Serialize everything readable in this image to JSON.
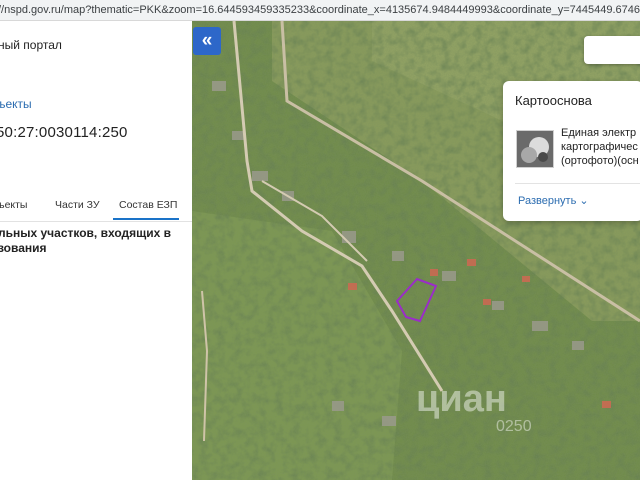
{
  "browser": {
    "url": "//nspd.gov.ru/map?thematic=PKK&zoom=16.644593459335233&coordinate_x=4135674.9484449993&coordinate_y=7445449.674639857&baseLa"
  },
  "panel": {
    "portal_title": "ный портал",
    "objects_link": "ъекты",
    "cadastral_number": "50:27:0030114:250",
    "tabs": [
      {
        "label": "ъекты",
        "active": false
      },
      {
        "label": "Части ЗУ",
        "active": false
      },
      {
        "label": "Состав ЕЗП",
        "active": true
      }
    ],
    "description": "льных участков, входящих в\nзования"
  },
  "map": {
    "collapse_glyph": "«",
    "basemap_card": {
      "title": "Картооснова",
      "layer_name": "Единая электр\nкартографичес\n(ортофото)(осн",
      "expand_label": "Развернуть",
      "expand_icon": "⌄"
    },
    "watermark_main": "циан",
    "watermark_sub": "0250"
  },
  "colors": {
    "accent": "#2d67c9",
    "link": "#2b6cb0",
    "parcel_outline": "#9b2cc9"
  }
}
